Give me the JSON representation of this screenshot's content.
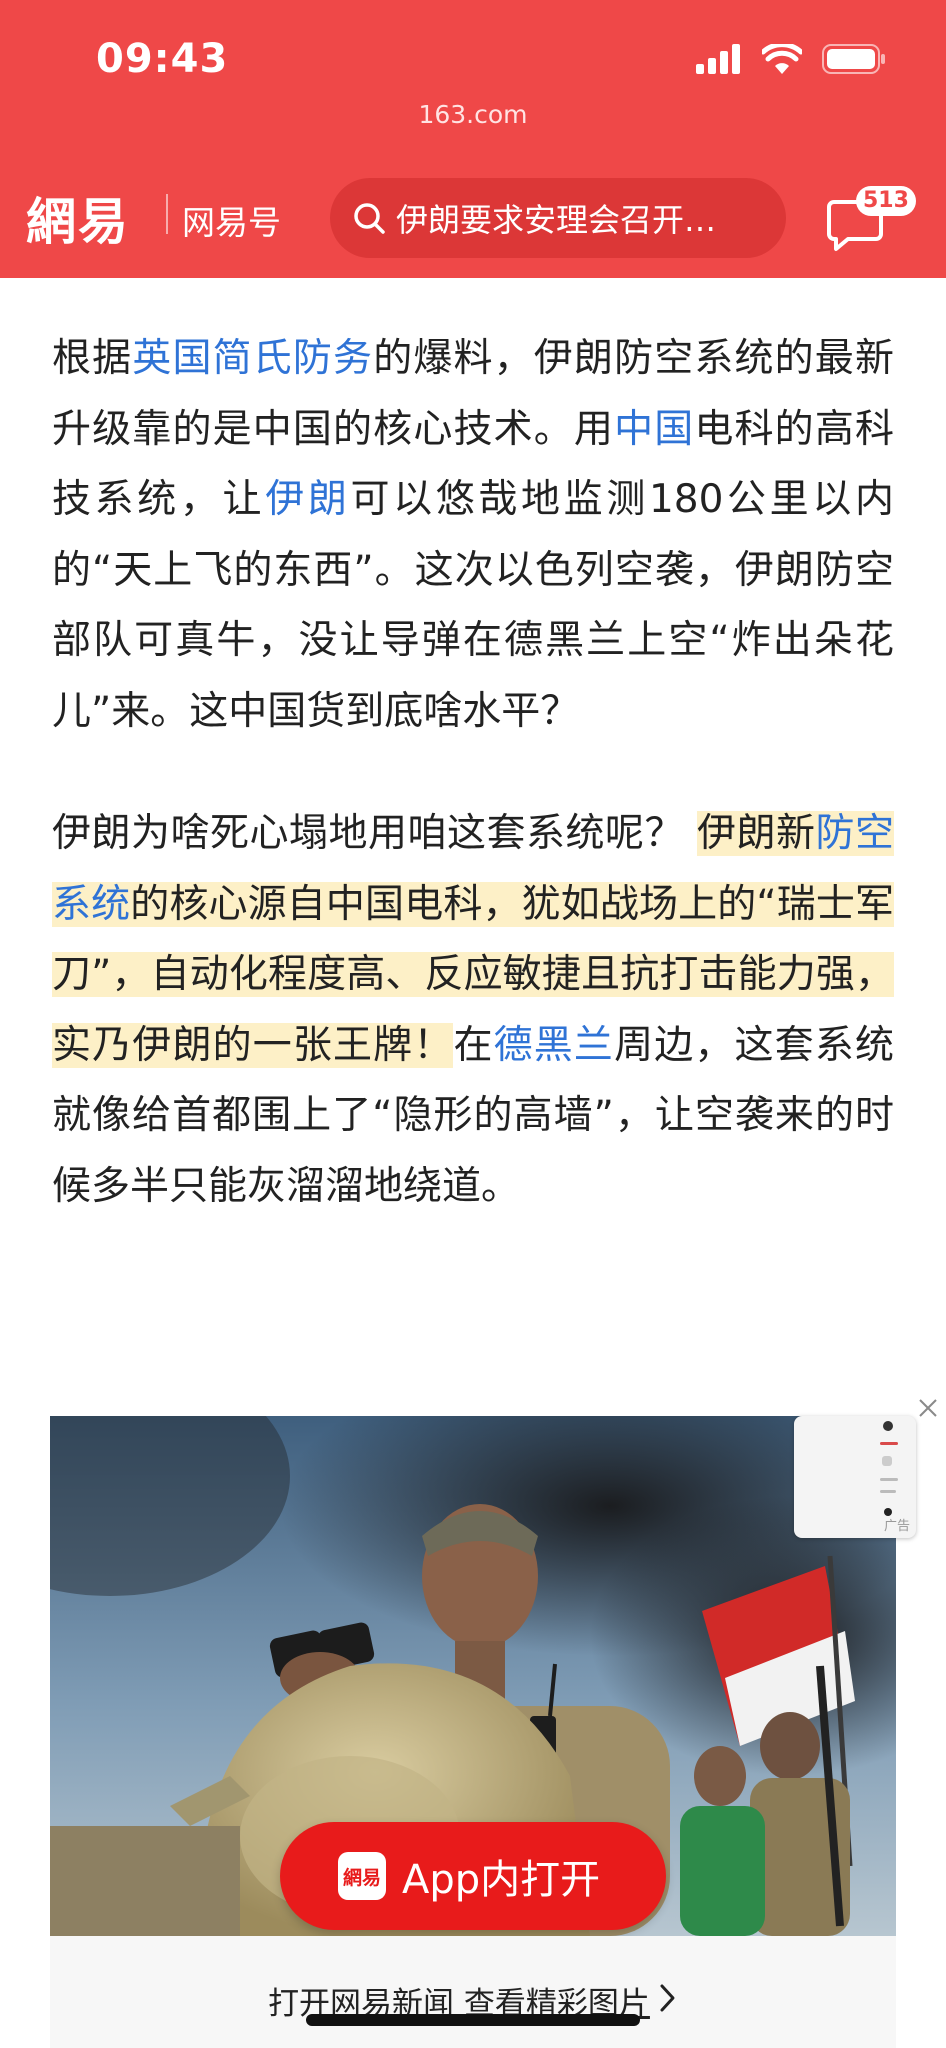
{
  "status_bar": {
    "time": "09:43"
  },
  "browser": {
    "domain": "163.com"
  },
  "header": {
    "logo": "網易",
    "channel": "网易号",
    "search_placeholder": "伊朗要求安理会召开…",
    "message_badge": "513"
  },
  "article": {
    "paragraph1": [
      {
        "text": "根据",
        "style": "plain"
      },
      {
        "text": "英国简氏防务",
        "style": "link"
      },
      {
        "text": "的爆料，伊朗防空系统的最新升级靠的是中国的核心技术。用",
        "style": "plain"
      },
      {
        "text": "中国",
        "style": "link"
      },
      {
        "text": "电科的高科技系统，让",
        "style": "plain"
      },
      {
        "text": "伊朗",
        "style": "link"
      },
      {
        "text": "可以悠哉地监测180公里以内的“天上飞的东西”。这次以色列空袭，伊朗防空部队可真牛，没让导弹在德黑兰上空“炸出朵花儿”来。这中国货到底啥水平？",
        "style": "plain"
      }
    ],
    "paragraph2": [
      {
        "text": "伊朗为啥死心塌地用咱这套系统呢？ ",
        "style": "plain"
      },
      {
        "text": "伊朗新",
        "style": "highlight"
      },
      {
        "text": "防空系统",
        "style": "highlight-link"
      },
      {
        "text": "的核心源自中国电科，犹如战场上的“瑞士军刀”，自动化程度高、反应敏捷且抗打击能力强，实乃伊朗的一张王牌！",
        "style": "highlight"
      },
      {
        "text": "在",
        "style": "plain"
      },
      {
        "text": "德黑兰",
        "style": "link"
      },
      {
        "text": "周边，这套系统就像给首都围上了“隐形的高墙”，让空袭来的时候多半只能灰溜溜地绕道。",
        "style": "plain"
      }
    ]
  },
  "image_card": {
    "ad_label": "广告",
    "app_button_logo": "網易",
    "app_button_label": "App内打开",
    "gallery_prefix": "打开网易新闻 ",
    "gallery_link": "查看精彩图片"
  },
  "colors": {
    "brand_red": "#ef4848",
    "link_blue": "#2f73d6",
    "highlight": "#fdf0c7",
    "button_red": "#e81b1b"
  }
}
